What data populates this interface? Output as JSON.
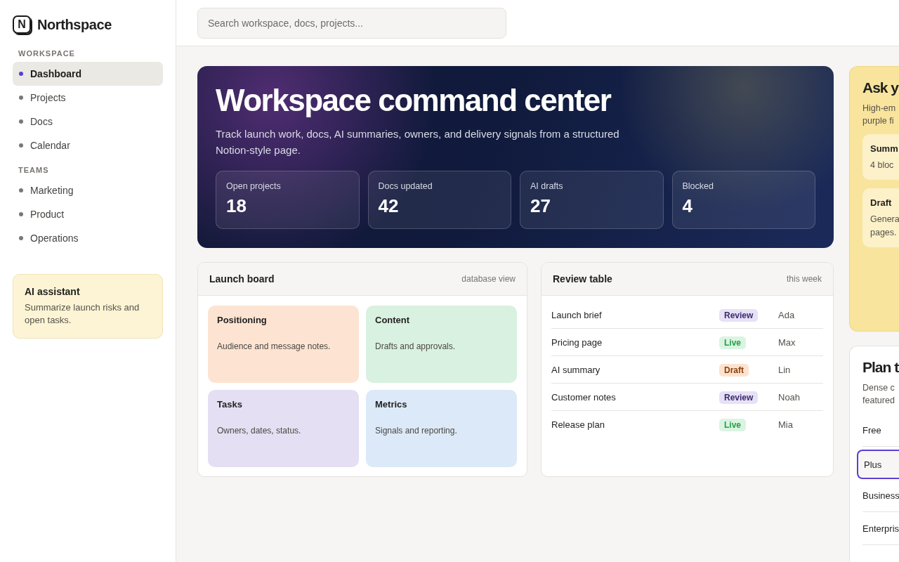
{
  "brand": {
    "logo_letter": "N",
    "name": "Northspace"
  },
  "sidebar": {
    "sections": [
      {
        "title": "WORKSPACE",
        "items": [
          {
            "label": "Dashboard",
            "selected": true
          },
          {
            "label": "Projects",
            "selected": false
          },
          {
            "label": "Docs",
            "selected": false
          },
          {
            "label": "Calendar",
            "selected": false
          }
        ]
      },
      {
        "title": "TEAMS",
        "items": [
          {
            "label": "Marketing",
            "selected": false
          },
          {
            "label": "Product",
            "selected": false
          },
          {
            "label": "Operations",
            "selected": false
          }
        ]
      }
    ],
    "assistant": {
      "title": "AI assistant",
      "text": "Summarize launch risks and open tasks."
    }
  },
  "search": {
    "placeholder": "Search workspace, docs, projects..."
  },
  "hero": {
    "title": "Workspace command center",
    "subtitle": "Track launch work, docs, AI summaries, owners, and delivery signals from a structured Notion-style page.",
    "stats": [
      {
        "label": "Open projects",
        "value": "18"
      },
      {
        "label": "Docs updated",
        "value": "42"
      },
      {
        "label": "AI drafts",
        "value": "27"
      },
      {
        "label": "Blocked",
        "value": "4"
      }
    ]
  },
  "launch_board": {
    "title": "Launch board",
    "meta": "database view",
    "tiles": [
      {
        "title": "Positioning",
        "text": "Audience and message notes.",
        "color": "#fde4d2"
      },
      {
        "title": "Content",
        "text": "Drafts and approvals.",
        "color": "#d9f1e0"
      },
      {
        "title": "Tasks",
        "text": "Owners, dates, status.",
        "color": "#e5dff3"
      },
      {
        "title": "Metrics",
        "text": "Signals and reporting.",
        "color": "#dce9f8"
      }
    ]
  },
  "review_table": {
    "title": "Review table",
    "meta": "this week",
    "rows": [
      {
        "name": "Launch brief",
        "status": "Review",
        "kind": "review",
        "owner": "Ada"
      },
      {
        "name": "Pricing page",
        "status": "Live",
        "kind": "live",
        "owner": "Max"
      },
      {
        "name": "AI summary",
        "status": "Draft",
        "kind": "draft",
        "owner": "Lin"
      },
      {
        "name": "Customer notes",
        "status": "Review",
        "kind": "review",
        "owner": "Noah"
      },
      {
        "name": "Release plan",
        "status": "Live",
        "kind": "live",
        "owner": "Mia"
      }
    ]
  },
  "ask_panel": {
    "title": "Ask y",
    "text_lines": [
      "High-em",
      "purple fi"
    ],
    "cards": [
      {
        "title": "Summ",
        "text_lines": [
          "4 bloc"
        ]
      },
      {
        "title": "Draft",
        "text_lines": [
          "Genera",
          "pages."
        ]
      }
    ]
  },
  "plan_panel": {
    "title": "Plan t",
    "text_lines": [
      "Dense c",
      "featured"
    ],
    "plans": [
      {
        "label": "Free",
        "selected": false
      },
      {
        "label": "Plus",
        "selected": true
      },
      {
        "label": "Business",
        "selected": false
      },
      {
        "label": "Enterpris",
        "selected": false
      }
    ]
  }
}
